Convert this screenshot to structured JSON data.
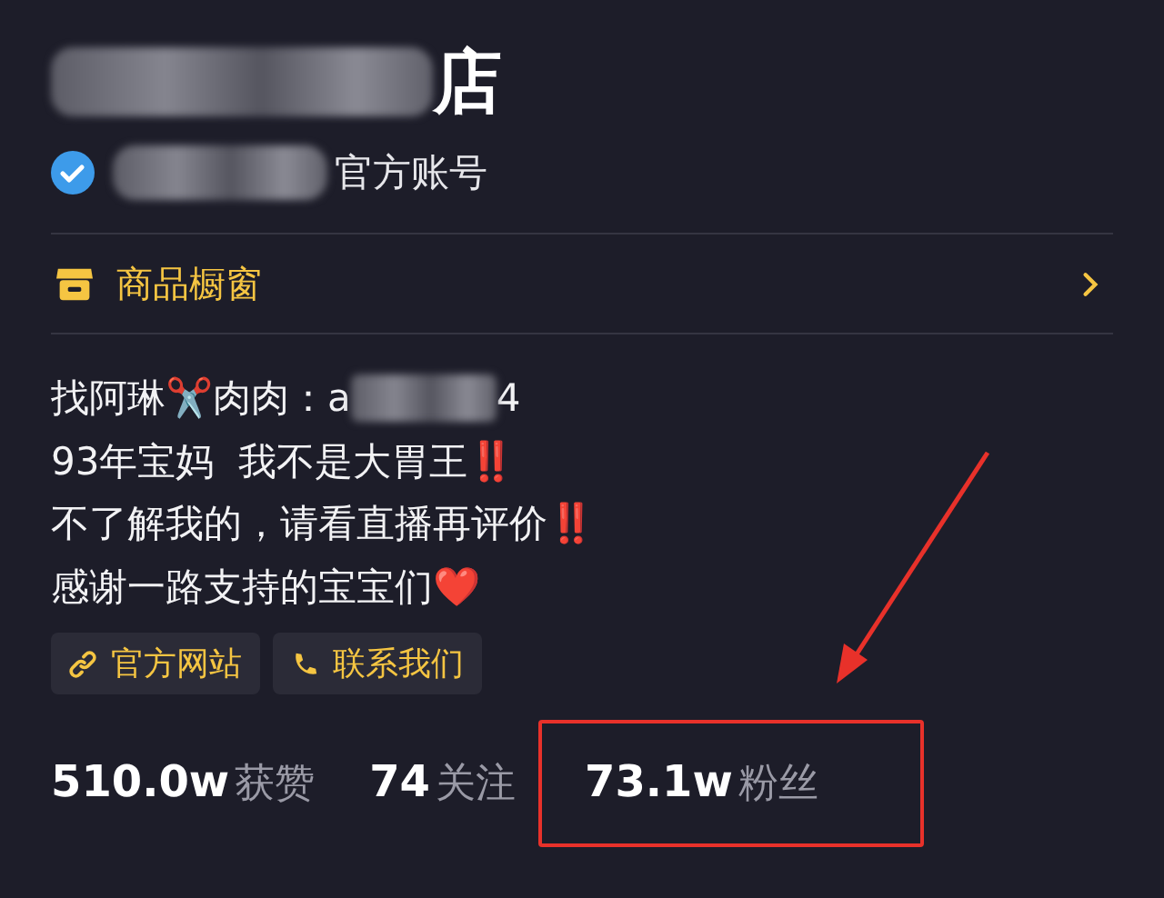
{
  "profile": {
    "name": "店",
    "name_redacted": true,
    "verification": {
      "text": "官方账号",
      "redacted": true
    }
  },
  "shop_entry": {
    "label": "商品橱窗"
  },
  "bio": [
    {
      "text": "找阿琳✂️肉肉：a",
      "redacted": true,
      "tail": "4"
    },
    {
      "text": "93年宝妈  我不是大胃王‼️",
      "redacted": false
    },
    {
      "text": "不了解我的，请看直播再评价‼️",
      "redacted": false
    },
    {
      "text": "感谢一路支持的宝宝们❤️",
      "redacted": false
    }
  ],
  "links": [
    {
      "label": "官方网站",
      "kind": "link"
    },
    {
      "label": "联系我们",
      "kind": "phone"
    }
  ],
  "stats": [
    {
      "count": "510.0w",
      "label": "获赞",
      "highlighted": false
    },
    {
      "count": "74",
      "label": "关注",
      "highlighted": false
    },
    {
      "count": "73.1w",
      "label": "粉丝",
      "highlighted": true
    }
  ],
  "annotation": {
    "arrow": true
  }
}
